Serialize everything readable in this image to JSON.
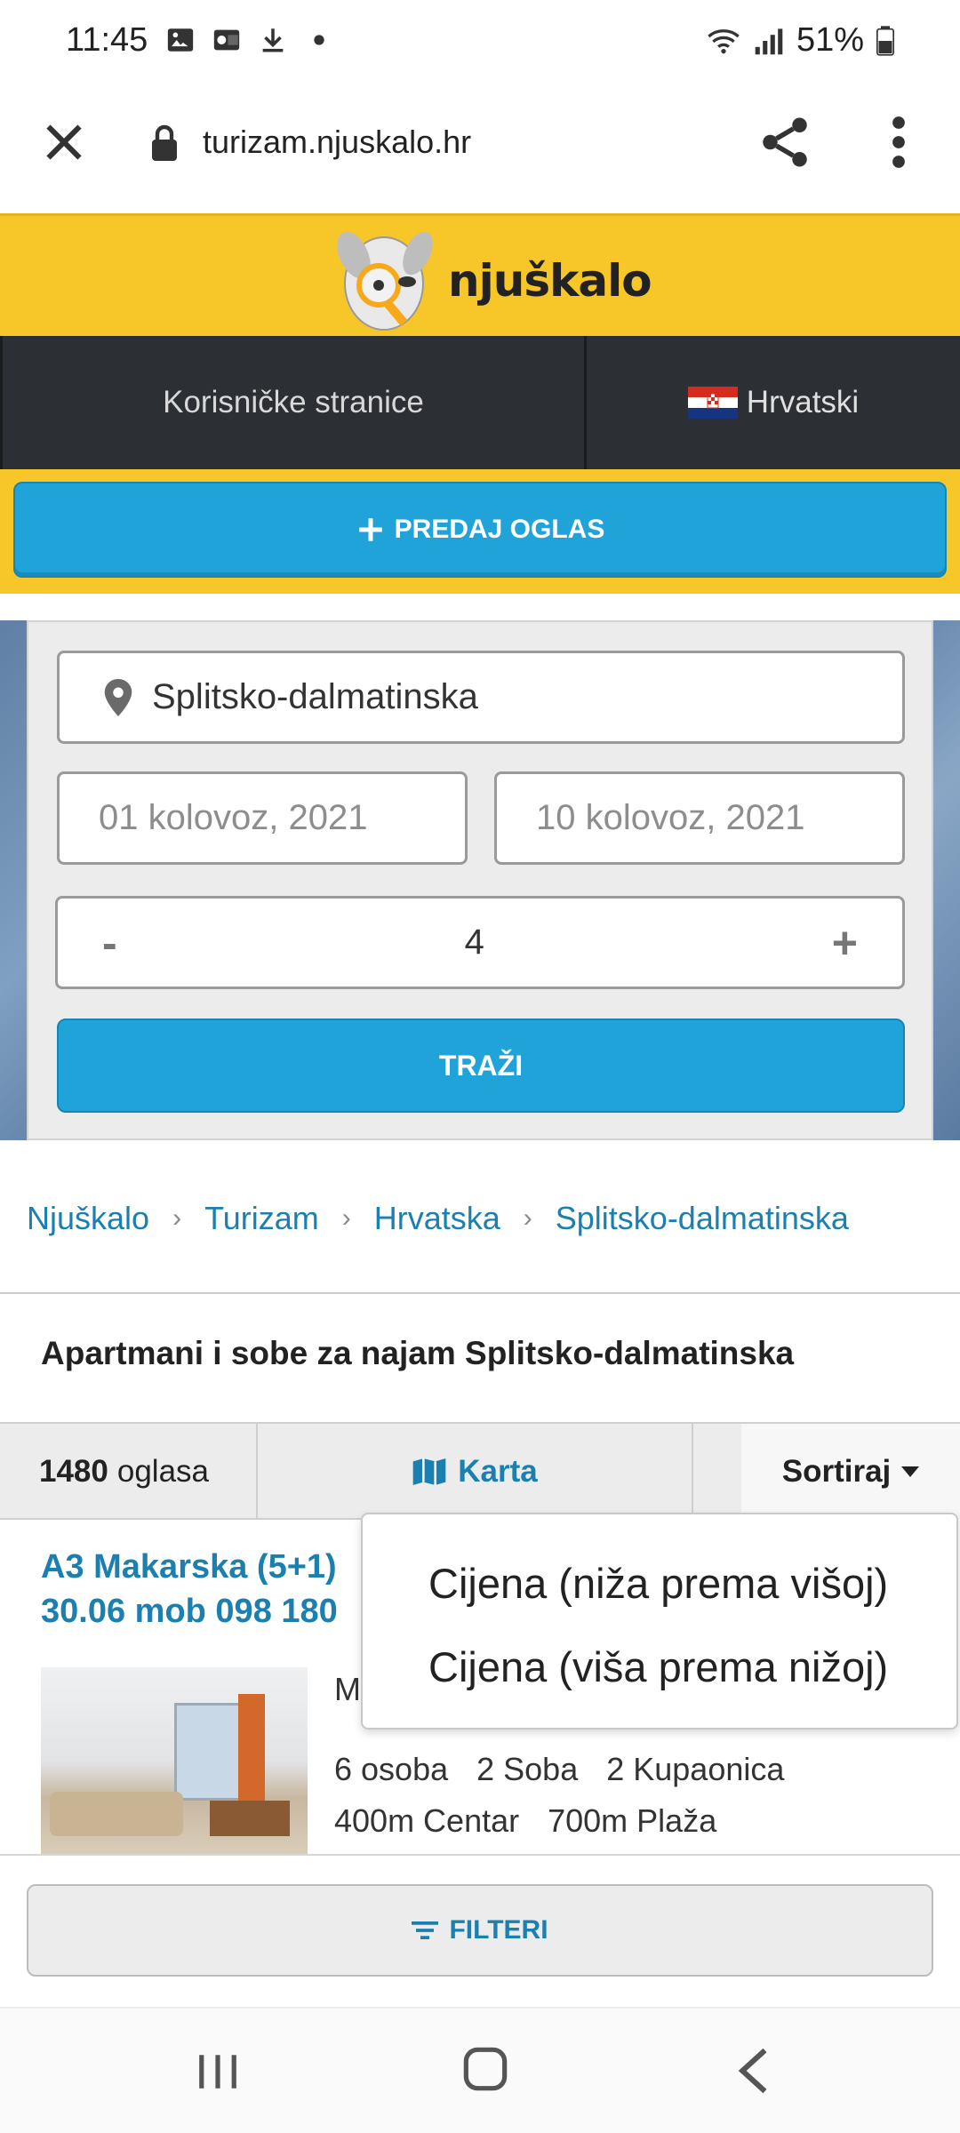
{
  "status_bar": {
    "time": "11:45",
    "battery": "51%"
  },
  "browser": {
    "url": "turizam.njuskalo.hr"
  },
  "site": {
    "logo_text": "njuškalo",
    "nav_left": "Korisničke stranice",
    "nav_lang": "Hrvatski",
    "post_ad_label": "PREDAJ OGLAS"
  },
  "search": {
    "location": "Splitsko-dalmatinska",
    "date_from": "01 kolovoz, 2021",
    "date_to": "10 kolovoz, 2021",
    "guests_minus": "-",
    "guests_count": "4",
    "guests_plus": "+",
    "search_label": "TRAŽI"
  },
  "breadcrumb": [
    "Njuškalo",
    "Turizam",
    "Hrvatska",
    "Splitsko-dalmatinska"
  ],
  "page_title": "Apartmani i sobe za najam Splitsko-dalmatinska",
  "toolbar": {
    "count": "1480",
    "count_suffix": "oglasa",
    "map_label": "Karta",
    "sort_label": "Sortiraj"
  },
  "sort_menu": {
    "options": [
      "Cijena (niža prema višoj)",
      "Cijena (viša prema nižoj)"
    ]
  },
  "listing": {
    "title_line1": "A3 Makarska (5+1)",
    "title_line2": "30.06 mob 098 180",
    "snippet": "M",
    "facts_row1": [
      "6 osoba",
      "2 Soba",
      "2 Kupaonica"
    ],
    "facts_row2": [
      "400m Centar",
      "700m Plaža"
    ]
  },
  "bottom": {
    "filter_label": "FILTERI"
  },
  "colors": {
    "brand_yellow": "#f7c72a",
    "brand_blue": "#1fa3d9",
    "link_blue": "#1b7fb0",
    "nav_dark": "#2c2f33"
  }
}
